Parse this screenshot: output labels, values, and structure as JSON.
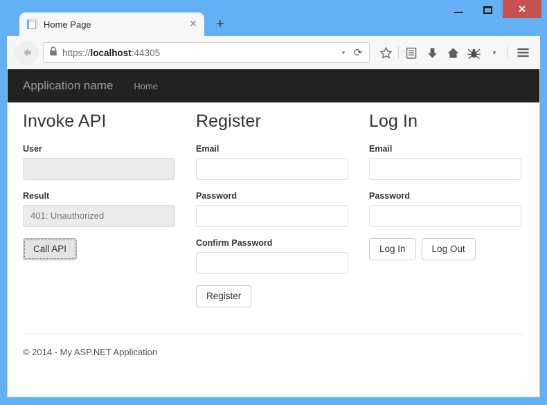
{
  "window": {
    "controls": {
      "minimize": "minimize-button",
      "maximize": "maximize-button",
      "close_label": "✕"
    },
    "close_color": "#c75050",
    "frame_color": "#63b0f5"
  },
  "tabs": {
    "active": {
      "title": "Home Page",
      "close_label": "✕",
      "favicon": "page-icon"
    },
    "new_tab_label": "+"
  },
  "toolbar": {
    "back_icon": "back-arrow-icon",
    "lock_icon": "padlock-icon",
    "url_scheme": "https://",
    "url_host": "localhost",
    "url_port": ":44305",
    "url_full": "https://localhost:44305",
    "url_dropdown_label": "▾",
    "reload_label": "⟳",
    "icons": [
      {
        "name": "bookmark-star-icon"
      },
      {
        "name": "reader-list-icon"
      },
      {
        "name": "downloads-icon"
      },
      {
        "name": "home-icon"
      },
      {
        "name": "firebug-icon"
      },
      {
        "name": "overflow-chevron-icon",
        "label": "▾"
      },
      {
        "name": "hamburger-menu-icon"
      }
    ]
  },
  "site_nav": {
    "brand": "Application name",
    "links": [
      {
        "label": "Home"
      }
    ]
  },
  "columns": [
    {
      "key": "invoke_api",
      "title": "Invoke API",
      "fields": [
        {
          "key": "user",
          "label": "User",
          "value": "",
          "placeholder": "",
          "disabled": true
        },
        {
          "key": "result",
          "label": "Result",
          "value": "401: Unauthorized",
          "placeholder": "",
          "disabled": true
        }
      ],
      "buttons": [
        {
          "key": "call_api",
          "label": "Call API",
          "focused": true
        }
      ]
    },
    {
      "key": "register",
      "title": "Register",
      "fields": [
        {
          "key": "email",
          "label": "Email",
          "value": "",
          "placeholder": "",
          "disabled": false
        },
        {
          "key": "password",
          "label": "Password",
          "value": "",
          "placeholder": "",
          "disabled": false
        },
        {
          "key": "confirm_password",
          "label": "Confirm Password",
          "value": "",
          "placeholder": "",
          "disabled": false
        }
      ],
      "buttons": [
        {
          "key": "register",
          "label": "Register",
          "focused": false
        }
      ]
    },
    {
      "key": "log_in",
      "title": "Log In",
      "fields": [
        {
          "key": "email",
          "label": "Email",
          "value": "",
          "placeholder": "",
          "disabled": false
        },
        {
          "key": "password",
          "label": "Password",
          "value": "",
          "placeholder": "",
          "disabled": false
        }
      ],
      "buttons": [
        {
          "key": "log_in",
          "label": "Log In",
          "focused": false
        },
        {
          "key": "log_out",
          "label": "Log Out",
          "focused": false
        }
      ]
    }
  ],
  "footer": {
    "text": "© 2014 - My ASP.NET Application"
  }
}
